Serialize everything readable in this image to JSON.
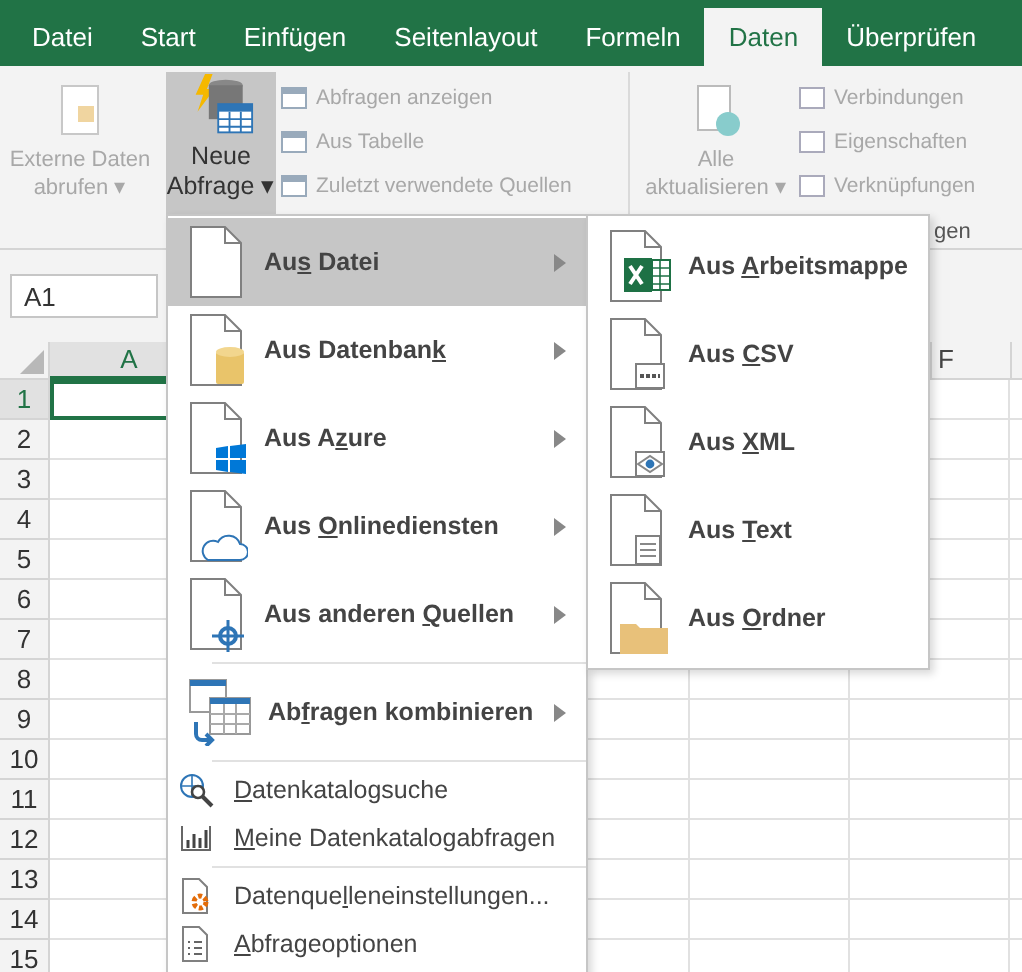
{
  "tabs": [
    {
      "label": "Datei",
      "selected": false
    },
    {
      "label": "Start",
      "selected": false
    },
    {
      "label": "Einfügen",
      "selected": false
    },
    {
      "label": "Seitenlayout",
      "selected": false
    },
    {
      "label": "Formeln",
      "selected": false
    },
    {
      "label": "Daten",
      "selected": true
    },
    {
      "label": "Überprüfen",
      "selected": false
    }
  ],
  "ribbon": {
    "external_data": {
      "lines": [
        "Externe Daten",
        "abrufen ▾"
      ],
      "disabled": true
    },
    "new_query": {
      "lines": [
        "Neue",
        "Abfrage ▾"
      ],
      "pressed": true
    },
    "query_commands": [
      {
        "label": "Abfragen anzeigen",
        "disabled": true
      },
      {
        "label": "Aus Tabelle",
        "disabled": true
      },
      {
        "label": "Zuletzt verwendete Quellen",
        "disabled": true
      }
    ],
    "refresh_all": {
      "lines": [
        "Alle",
        "aktualisieren ▾"
      ],
      "disabled": true
    },
    "connection_commands": [
      {
        "label": "Verbindungen",
        "disabled": true
      },
      {
        "label": "Eigenschaften",
        "disabled": true
      },
      {
        "label": "Verknüpfungen",
        "disabled": true
      }
    ],
    "group_label": "gen"
  },
  "name_box": "A1",
  "sheet": {
    "columns": [
      {
        "label": "A",
        "selected": true
      },
      {
        "label": "F",
        "selected": false
      }
    ],
    "rows": [
      {
        "label": "1",
        "selected": true
      },
      {
        "label": "2",
        "selected": false
      },
      {
        "label": "3",
        "selected": false
      },
      {
        "label": "4",
        "selected": false
      },
      {
        "label": "5",
        "selected": false
      },
      {
        "label": "6",
        "selected": false
      },
      {
        "label": "7",
        "selected": false
      },
      {
        "label": "8",
        "selected": false
      },
      {
        "label": "9",
        "selected": false
      },
      {
        "label": "10",
        "selected": false
      },
      {
        "label": "11",
        "selected": false
      },
      {
        "label": "12",
        "selected": false
      },
      {
        "label": "13",
        "selected": false
      },
      {
        "label": "14",
        "selected": false
      },
      {
        "label": "15",
        "selected": false
      }
    ]
  },
  "menu": {
    "sections": [
      [
        {
          "kind": "large",
          "pre": "Au",
          "key": "s",
          "post": " Datei",
          "submenu": true,
          "selected": true
        },
        {
          "kind": "large",
          "pre": "Aus Datenban",
          "key": "k",
          "submenu": true,
          "selected": false
        },
        {
          "kind": "large",
          "pre": "Aus A",
          "key": "z",
          "post": "ure",
          "submenu": true,
          "selected": false
        },
        {
          "kind": "large",
          "pre": "Aus ",
          "key": "O",
          "post": "nlinediensten",
          "submenu": true,
          "selected": false
        },
        {
          "kind": "large",
          "pre": "Aus anderen ",
          "key": "Q",
          "post": "uellen",
          "submenu": true,
          "selected": false
        }
      ],
      [
        {
          "kind": "large",
          "pre": "Ab",
          "key": "f",
          "post": "ragen kombinieren",
          "submenu": true,
          "selected": false
        }
      ],
      [
        {
          "kind": "small",
          "key": "D",
          "post": "atenkatalogsuche",
          "submenu": false,
          "selected": false
        },
        {
          "kind": "small",
          "key": "M",
          "post": "eine Datenkatalogabfragen",
          "submenu": false,
          "selected": false
        }
      ],
      [
        {
          "kind": "small",
          "pre": "Datenque",
          "key": "l",
          "post": "leneinstellungen...",
          "submenu": false,
          "selected": false
        },
        {
          "kind": "small",
          "key": "A",
          "post": "bfrageoptionen",
          "submenu": false,
          "selected": false
        }
      ]
    ]
  },
  "submenu": {
    "items": [
      {
        "pre": "Aus ",
        "key": "A",
        "post": "rbeitsmappe"
      },
      {
        "pre": "Aus ",
        "key": "C",
        "post": "SV"
      },
      {
        "pre": "Aus ",
        "key": "X",
        "post": "ML"
      },
      {
        "pre": "Aus ",
        "key": "T",
        "post": "ext"
      },
      {
        "pre": "Aus ",
        "key": "O",
        "post": "rdner"
      }
    ]
  }
}
